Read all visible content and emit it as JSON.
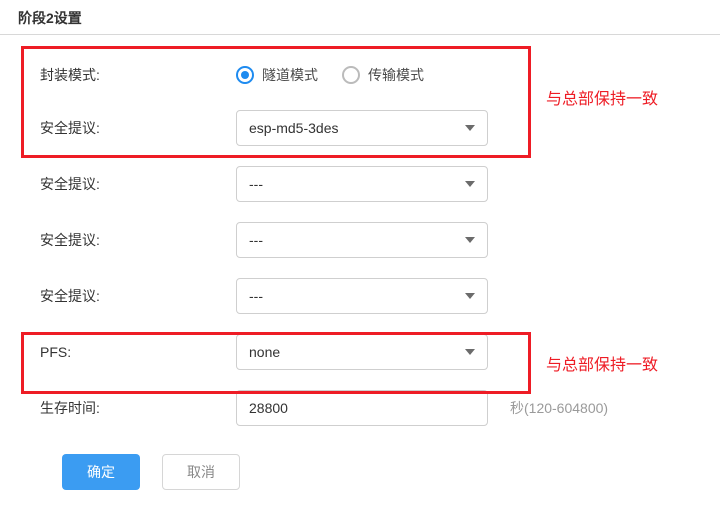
{
  "header": {
    "title": "阶段2设置"
  },
  "form": {
    "encapsulation": {
      "label": "封装模式:",
      "options": [
        {
          "text": "隧道模式",
          "checked": true
        },
        {
          "text": "传输模式",
          "checked": false
        }
      ]
    },
    "proposal1": {
      "label": "安全提议:",
      "value": "esp-md5-3des"
    },
    "proposal2": {
      "label": "安全提议:",
      "value": "---"
    },
    "proposal3": {
      "label": "安全提议:",
      "value": "---"
    },
    "proposal4": {
      "label": "安全提议:",
      "value": "---"
    },
    "pfs": {
      "label": "PFS:",
      "value": "none"
    },
    "lifetime": {
      "label": "生存时间:",
      "value": "28800",
      "suffix": "秒(120-604800)"
    }
  },
  "buttons": {
    "ok": "确定",
    "cancel": "取消"
  },
  "annotations": {
    "note1": "与总部保持一致",
    "note2": "与总部保持一致"
  }
}
